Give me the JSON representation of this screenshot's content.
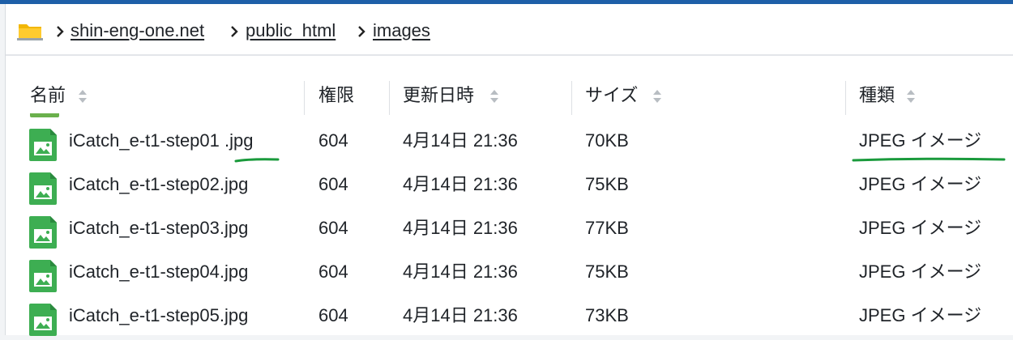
{
  "breadcrumb": {
    "folder_icon": "folder-icon",
    "items": [
      "shin-eng-one.net",
      "public_html",
      "images"
    ]
  },
  "columns": {
    "name": "名前",
    "permission": "権限",
    "modified": "更新日時",
    "size": "サイズ",
    "type": "種類"
  },
  "files": [
    {
      "name": "iCatch_e-t1-step01 .jpg",
      "permission": "604",
      "modified": "4月14日 21:36",
      "size": "70KB",
      "type": "JPEG イメージ"
    },
    {
      "name": "iCatch_e-t1-step02.jpg",
      "permission": "604",
      "modified": "4月14日 21:36",
      "size": "75KB",
      "type": "JPEG イメージ"
    },
    {
      "name": "iCatch_e-t1-step03.jpg",
      "permission": "604",
      "modified": "4月14日 21:36",
      "size": "77KB",
      "type": "JPEG イメージ"
    },
    {
      "name": "iCatch_e-t1-step04.jpg",
      "permission": "604",
      "modified": "4月14日 21:36",
      "size": "75KB",
      "type": "JPEG イメージ"
    },
    {
      "name": "iCatch_e-t1-step05.jpg",
      "permission": "604",
      "modified": "4月14日 21:36",
      "size": "73KB",
      "type": "JPEG イメージ"
    }
  ],
  "colors": {
    "accent_bar": "#1e5fa8",
    "image_icon": "#3dae52",
    "annotation": "#1a9a3c",
    "folder": "#f2b705"
  }
}
